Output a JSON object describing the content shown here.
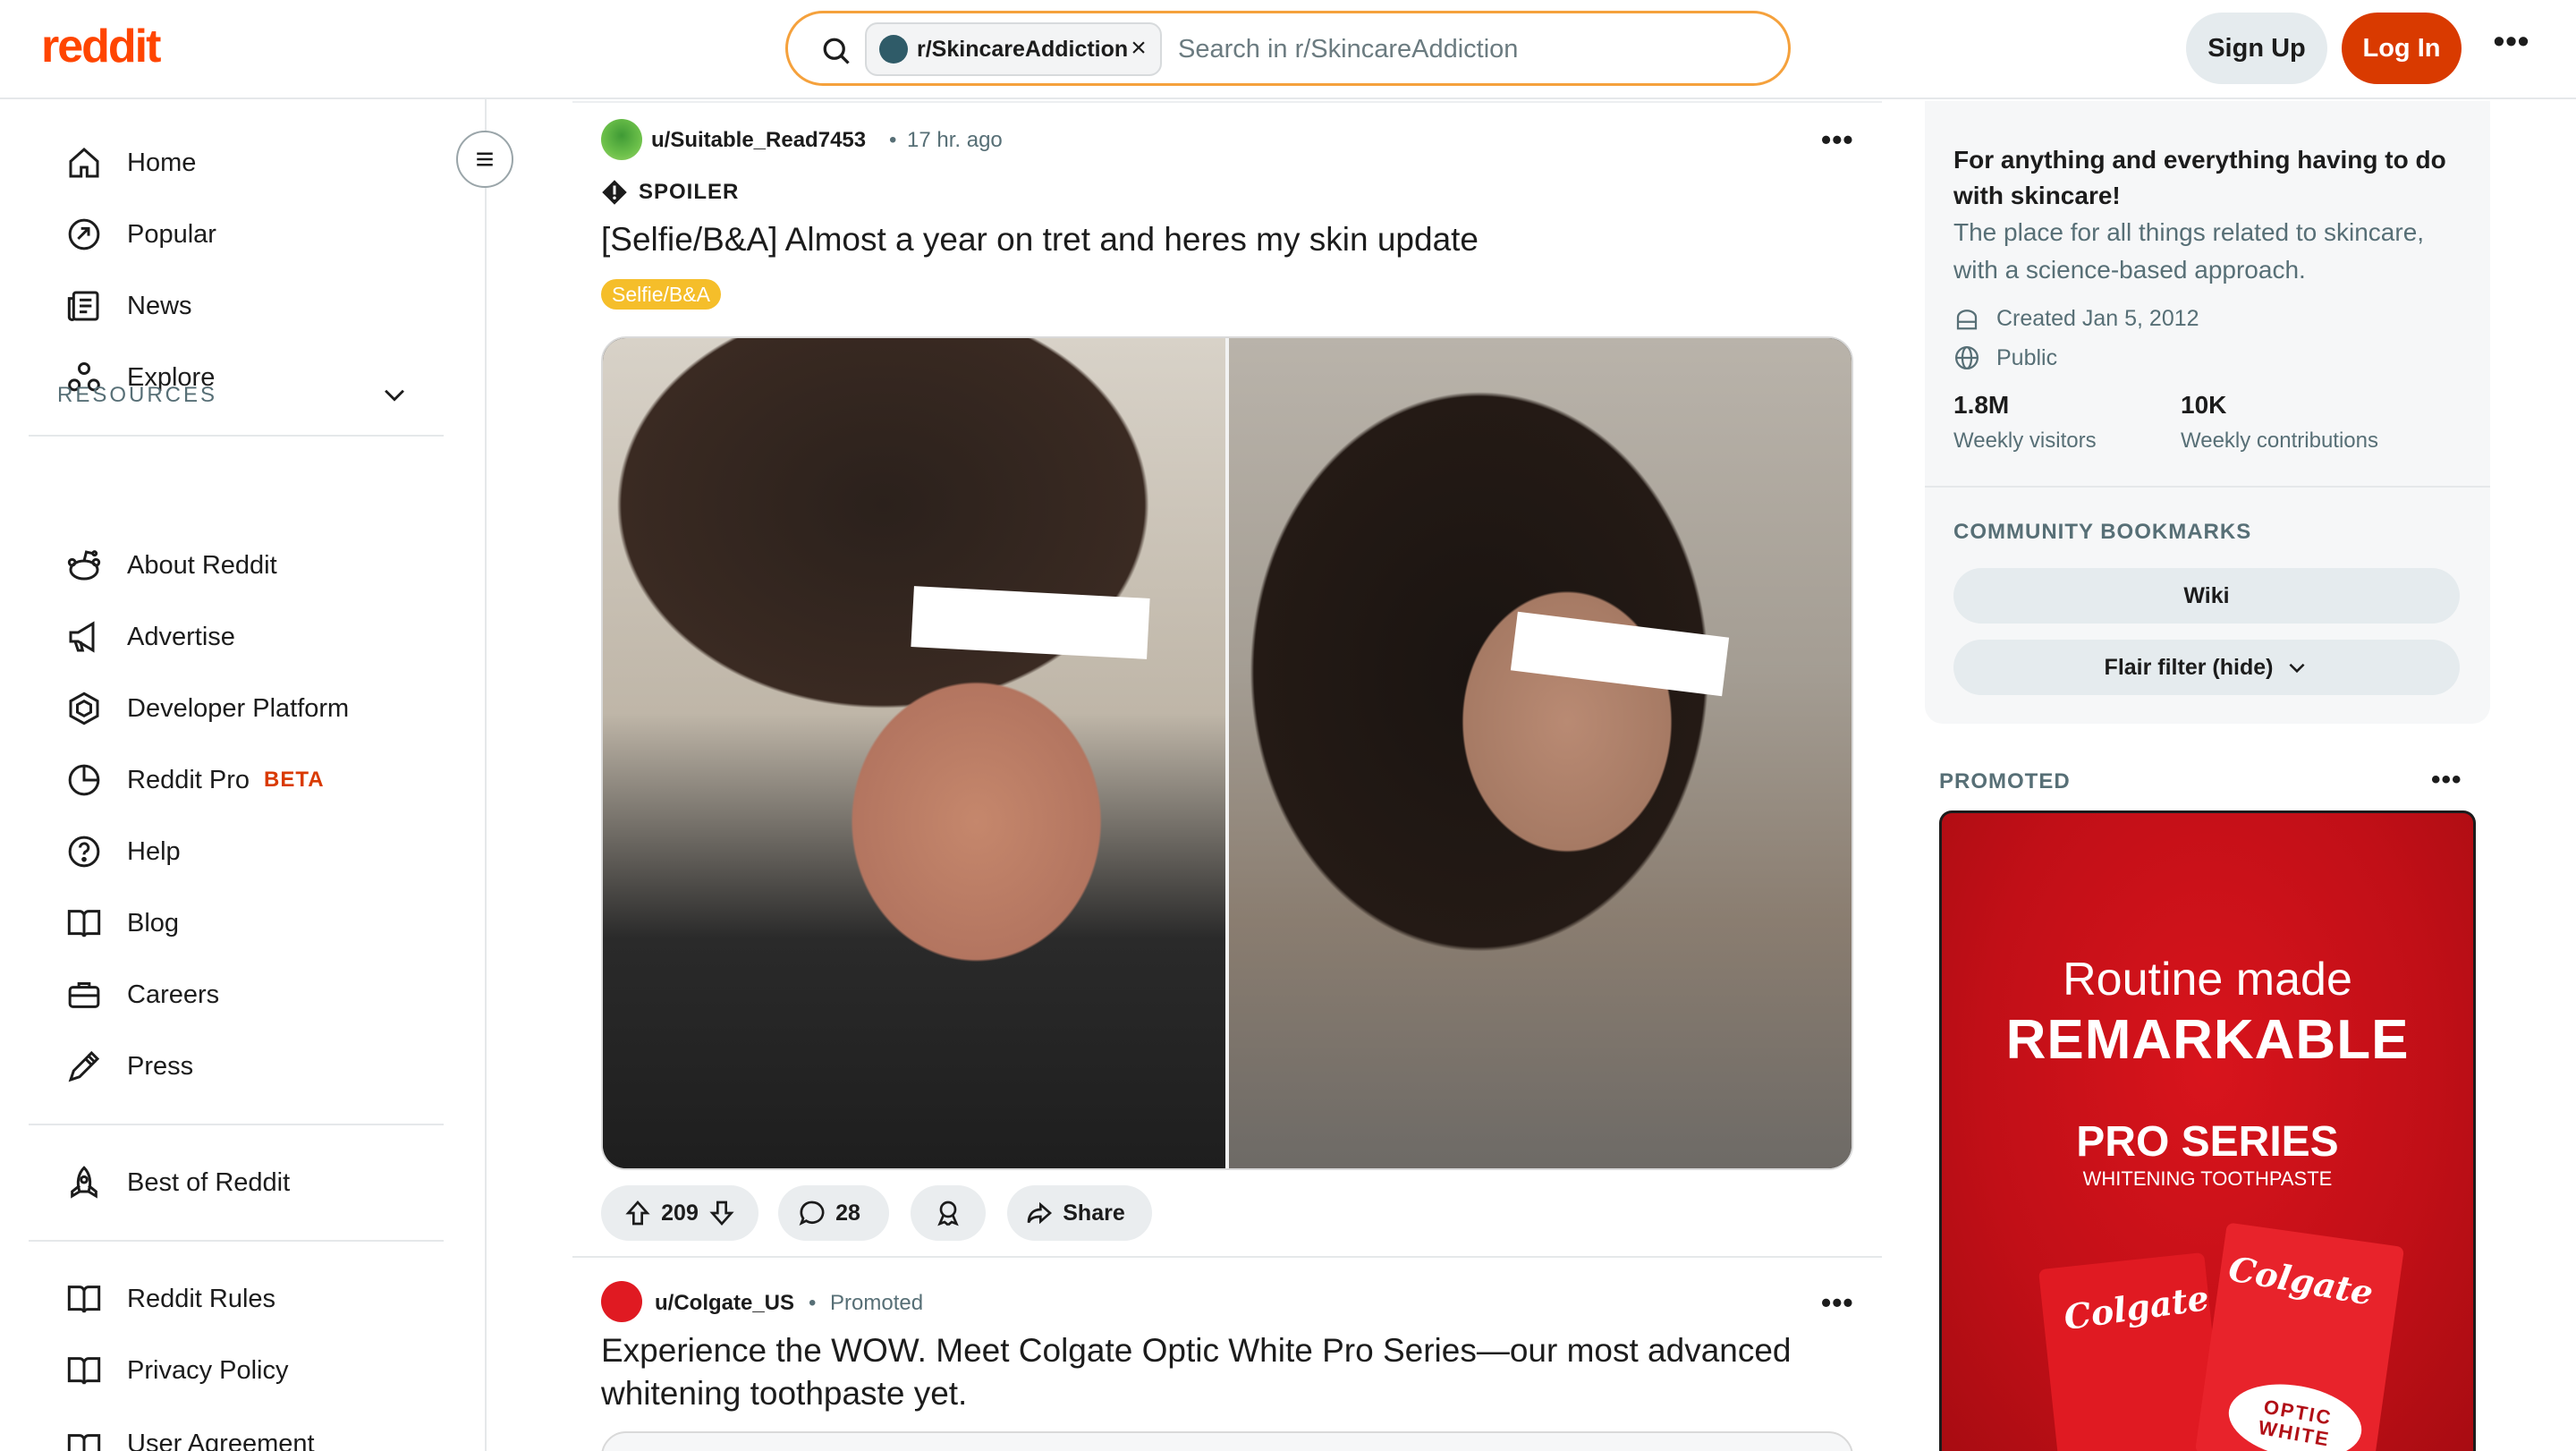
{
  "header": {
    "logo": "reddit",
    "subreddit_chip": "r/SkincareAddiction",
    "search_placeholder": "Search in r/SkincareAddiction",
    "signup_label": "Sign Up",
    "login_label": "Log In",
    "brand_color": "#ff4500",
    "login_color": "#d93a00"
  },
  "sidebar": {
    "main_items": [
      {
        "label": "Home",
        "icon": "home-icon"
      },
      {
        "label": "Popular",
        "icon": "popular-icon"
      },
      {
        "label": "News",
        "icon": "news-icon"
      },
      {
        "label": "Explore",
        "icon": "explore-icon"
      }
    ],
    "resources_title": "RESOURCES",
    "resource_items": [
      {
        "label": "About Reddit",
        "icon": "reddit-alien-icon"
      },
      {
        "label": "Advertise",
        "icon": "megaphone-icon"
      },
      {
        "label": "Developer Platform",
        "icon": "developer-icon"
      },
      {
        "label": "Reddit Pro",
        "icon": "pie-chart-icon",
        "badge": "BETA"
      },
      {
        "label": "Help",
        "icon": "help-icon"
      },
      {
        "label": "Blog",
        "icon": "book-icon"
      },
      {
        "label": "Careers",
        "icon": "briefcase-icon"
      },
      {
        "label": "Press",
        "icon": "pen-icon"
      }
    ],
    "best_of": {
      "label": "Best of Reddit",
      "icon": "rocket-icon"
    },
    "legal_items": [
      {
        "label": "Reddit Rules",
        "icon": "book-icon"
      },
      {
        "label": "Privacy Policy",
        "icon": "book-icon"
      },
      {
        "label": "User Agreement",
        "icon": "book-icon"
      }
    ]
  },
  "posts": [
    {
      "author": "u/Suitable_Read7453",
      "separator": "•",
      "time": "17 hr. ago",
      "spoiler_label": "SPOILER",
      "title": "[Selfie/B&A] Almost a year on tret and heres my skin update",
      "flair": "Selfie/B&A",
      "flair_color": "#f5be2a",
      "votes": "209",
      "comments": "28",
      "share_label": "Share"
    },
    {
      "author": "u/Colgate_US",
      "separator": "•",
      "time": "Promoted",
      "title": "Experience the WOW. Meet Colgate Optic White Pro Series—our most advanced whitening toothpaste yet."
    }
  ],
  "about": {
    "title": "For anything and everything having to do with skincare!",
    "description": "The place for all things related to skincare, with a science-based approach.",
    "created": "Created Jan 5, 2012",
    "visibility": "Public",
    "stats": [
      {
        "value": "1.8M",
        "label": "Weekly visitors"
      },
      {
        "value": "10K",
        "label": "Weekly contributions"
      }
    ],
    "bookmarks_title": "COMMUNITY BOOKMARKS",
    "bookmarks": [
      "Wiki",
      "Flair filter (hide)"
    ]
  },
  "promoted": {
    "label": "PROMOTED",
    "ad_line1": "Routine made",
    "ad_line2": "REMARKABLE",
    "ad_line3": "PRO SERIES",
    "ad_line4": "WHITENING TOOTHPASTE",
    "ad_brand_left": "Colgate",
    "ad_brand_right": "Colgate",
    "ad_product": "OPTIC WHITE",
    "ad_color": "#c10f17"
  }
}
